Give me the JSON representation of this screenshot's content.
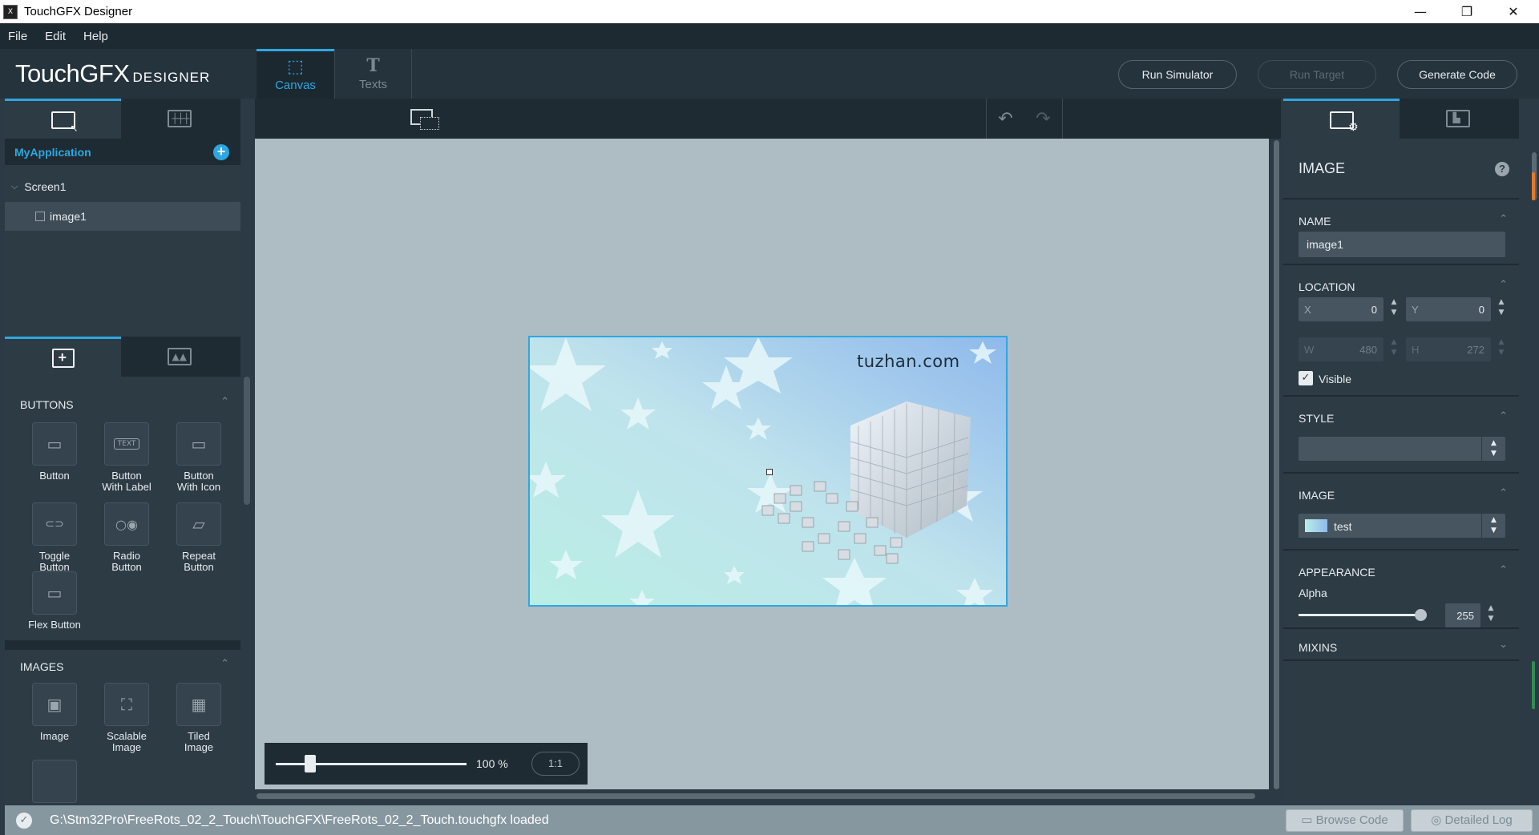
{
  "window": {
    "title": "TouchGFX Designer",
    "app_icon": "app-icon",
    "controls": {
      "minimize": "—",
      "restore": "❐",
      "close": "✕"
    }
  },
  "menu": {
    "items": [
      "File",
      "Edit",
      "Help"
    ]
  },
  "toolbar": {
    "logo_main": "TouchGFX",
    "logo_sub": "DESIGNER",
    "tabs": [
      {
        "label": "Canvas",
        "icon": "canvas-icon",
        "glyph": "⬚",
        "active": true
      },
      {
        "label": "Texts",
        "icon": "texts-icon",
        "glyph": "T",
        "active": false
      }
    ],
    "run_simulator": "Run Simulator",
    "run_target": "Run Target",
    "generate_code": "Generate Code"
  },
  "left_panel": {
    "app_name": "MyApplication",
    "add_icon": "+",
    "tree": {
      "screen": "Screen1",
      "widget": "image1"
    },
    "sections": [
      {
        "title": "BUTTONS",
        "widgets": [
          {
            "label": "Button",
            "icon": "button-icon",
            "glyph": "▭"
          },
          {
            "label": "Button\nWith Label",
            "icon": "button-with-label-icon",
            "glyph": "TEXT"
          },
          {
            "label": "Button\nWith Icon",
            "icon": "button-with-icon-icon",
            "glyph": "▭"
          },
          {
            "label": "Toggle\nButton",
            "icon": "toggle-button-icon",
            "glyph": "⊂⊃"
          },
          {
            "label": "Radio\nButton",
            "icon": "radio-button-icon",
            "glyph": "○◉"
          },
          {
            "label": "Repeat\nButton",
            "icon": "repeat-button-icon",
            "glyph": "▱"
          },
          {
            "label": "Flex Button",
            "icon": "flex-button-icon",
            "glyph": "▭"
          }
        ]
      },
      {
        "title": "IMAGES",
        "widgets": [
          {
            "label": "Image",
            "icon": "image-icon",
            "glyph": "▣"
          },
          {
            "label": "Scalable\nImage",
            "icon": "scalable-image-icon",
            "glyph": "⛶"
          },
          {
            "label": "Tiled\nImage",
            "icon": "tiled-image-icon",
            "glyph": "▦"
          }
        ]
      }
    ]
  },
  "canvas": {
    "watermark": "tuzhan.com",
    "zoom": "100 %",
    "zoom_level": 0.18,
    "zoom_reset": "1:1",
    "undo_icon": "↶",
    "redo_icon": "↷"
  },
  "properties": {
    "header": "IMAGE",
    "help": "?",
    "name_title": "NAME",
    "name_value": "image1",
    "location_title": "LOCATION",
    "x_label": "X",
    "x_value": "0",
    "y_label": "Y",
    "y_value": "0",
    "w_label": "W",
    "w_value": "480",
    "h_label": "H",
    "h_value": "272",
    "visible_label": "Visible",
    "visible_checked": true,
    "style_title": "STYLE",
    "image_title": "IMAGE",
    "image_value": "test",
    "appearance_title": "APPEARANCE",
    "alpha_label": "Alpha",
    "alpha_value": "255",
    "alpha_level": 1.0,
    "mixins_title": "MIXINS"
  },
  "status": {
    "message": "G:\\Stm32Pro\\FreeRots_02_2_Touch\\TouchGFX\\FreeRots_02_2_Touch.touchgfx loaded",
    "browse_code": "Browse Code",
    "detailed_log": "Detailed Log"
  },
  "colors": {
    "accent": "#2ea7e0",
    "panel": "#2d3b45",
    "canvas_bg": "#aebcc3",
    "status_bar": "#8797a0"
  }
}
